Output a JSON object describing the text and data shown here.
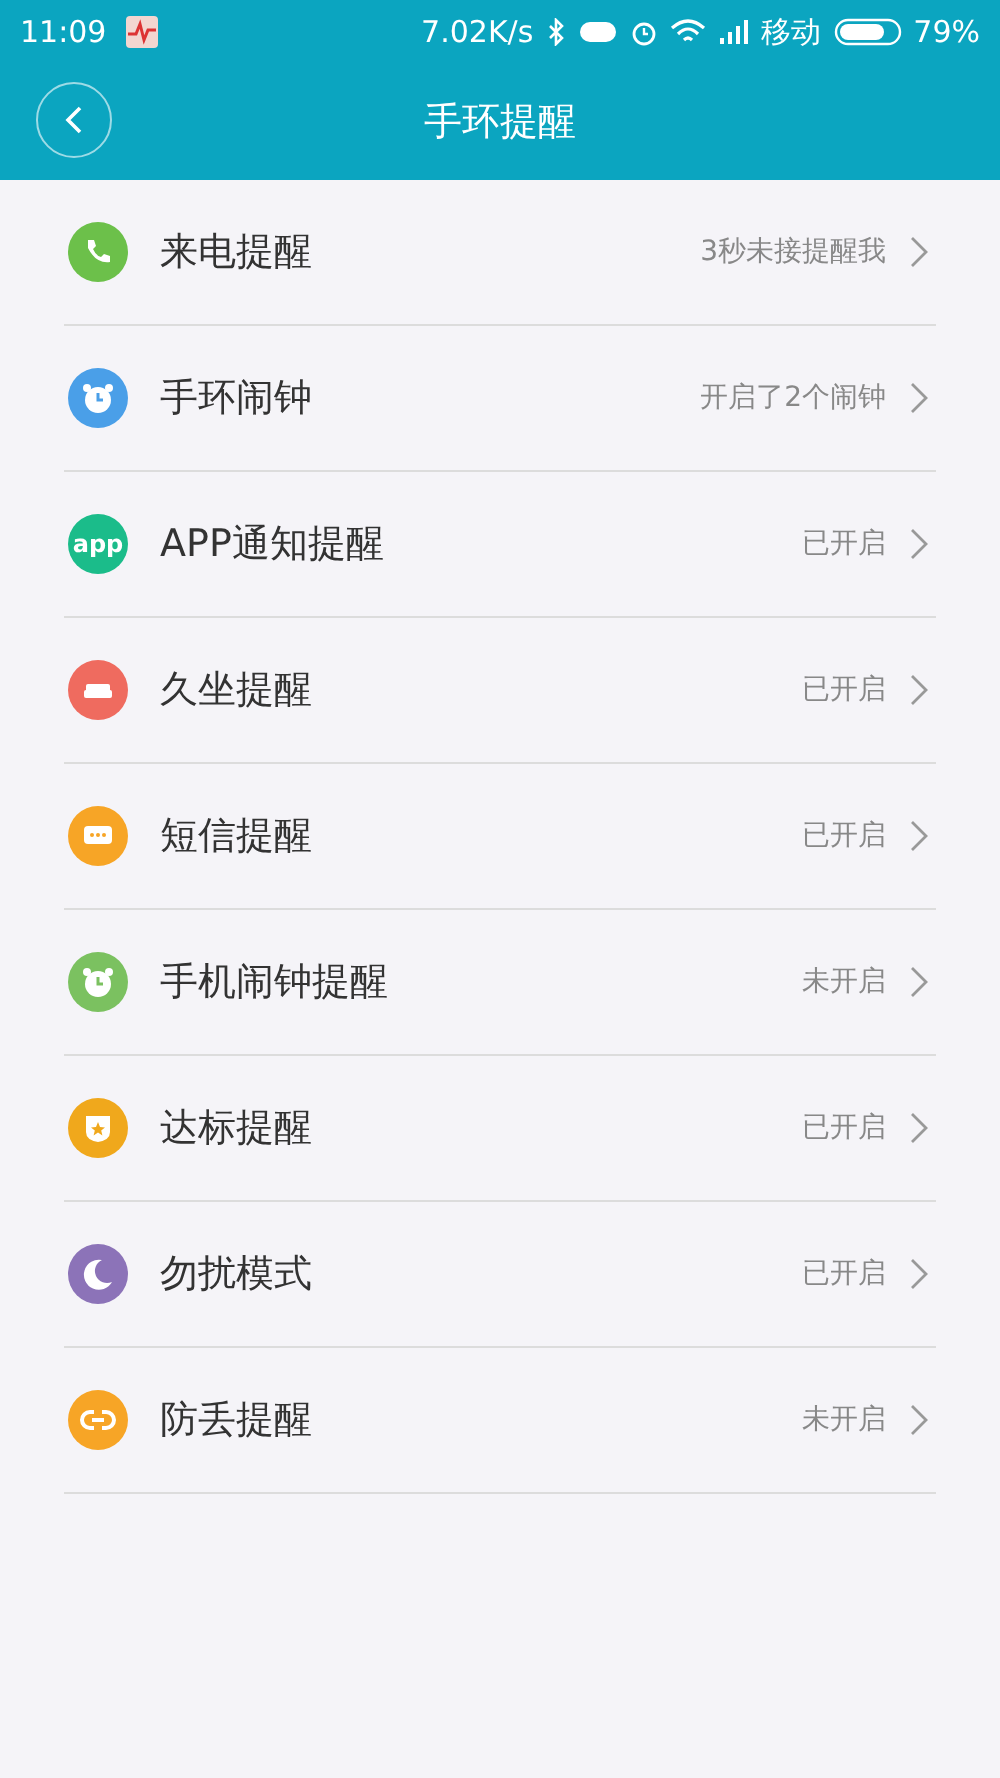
{
  "status_bar": {
    "time": "11:09",
    "speed": "7.02K/s",
    "carrier": "移动",
    "battery": "79%"
  },
  "header": {
    "title": "手环提醒"
  },
  "items": [
    {
      "kind": "phone",
      "color": "#6cc04a",
      "label": "来电提醒",
      "value": "3秒未接提醒我"
    },
    {
      "kind": "alarm",
      "color": "#4a9fe8",
      "label": "手环闹钟",
      "value": "开启了2个闹钟"
    },
    {
      "kind": "app",
      "icon_text": "app",
      "color": "#1bbc8a",
      "label": "APP通知提醒",
      "value": "已开启"
    },
    {
      "kind": "sofa",
      "color": "#ef6b5f",
      "label": "久坐提醒",
      "value": "已开启"
    },
    {
      "kind": "chat",
      "color": "#f7a526",
      "label": "短信提醒",
      "value": "已开启"
    },
    {
      "kind": "alarm",
      "color": "#7bc160",
      "label": "手机闹钟提醒",
      "value": "未开启"
    },
    {
      "kind": "badge",
      "color": "#f0a81c",
      "label": "达标提醒",
      "value": "已开启"
    },
    {
      "kind": "moon",
      "color": "#8c73b8",
      "label": "勿扰模式",
      "value": "已开启"
    },
    {
      "kind": "link",
      "color": "#f7a526",
      "label": "防丢提醒",
      "value": "未开启"
    }
  ]
}
